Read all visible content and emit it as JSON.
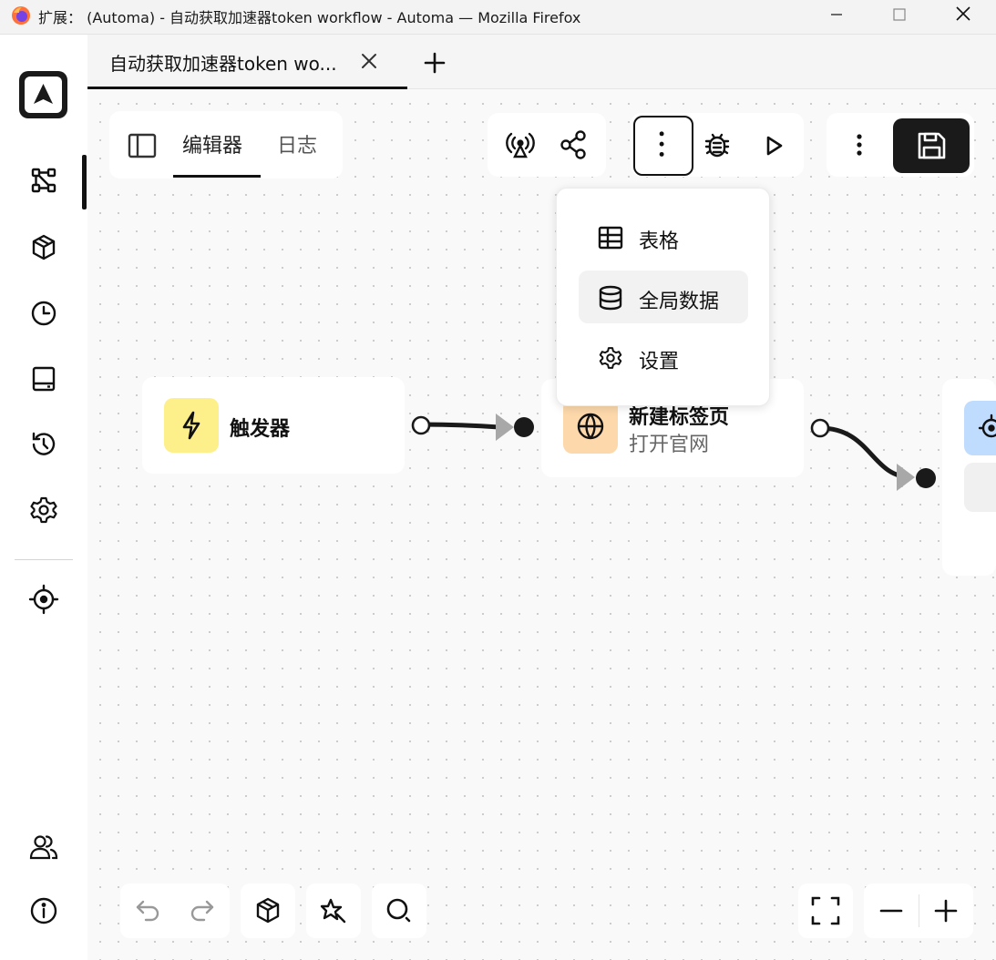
{
  "window": {
    "title": "扩展： (Automa) - 自动获取加速器token workflow - Automa — Mozilla Firefox"
  },
  "sidebar": {
    "items": [
      {
        "name": "workflows",
        "icon": "workflow-icon"
      },
      {
        "name": "packages",
        "icon": "cube-icon"
      },
      {
        "name": "schedule",
        "icon": "clock-icon"
      },
      {
        "name": "storage",
        "icon": "storage-icon"
      },
      {
        "name": "logs",
        "icon": "history-icon"
      },
      {
        "name": "settings",
        "icon": "gear-icon"
      },
      {
        "name": "recording",
        "icon": "target-icon"
      },
      {
        "name": "team",
        "icon": "users-icon"
      },
      {
        "name": "about",
        "icon": "info-icon"
      }
    ]
  },
  "tabs": [
    {
      "label": "自动获取加速器token wo...",
      "active": true
    }
  ],
  "editor": {
    "tab_editor": "编辑器",
    "tab_log": "日志"
  },
  "menu": {
    "items": [
      {
        "label": "表格",
        "icon": "table-icon"
      },
      {
        "label": "全局数据",
        "icon": "database-icon",
        "hovered": true
      },
      {
        "label": "设置",
        "icon": "gear-icon"
      }
    ]
  },
  "nodes": [
    {
      "title": "触发器",
      "description": "",
      "icon": "bolt-icon",
      "color": "#fdf08a"
    },
    {
      "title": "新建标签页",
      "description": "打开官网",
      "icon": "globe-icon",
      "color": "#fcd8ab"
    },
    {
      "title": "",
      "description": "",
      "icon": "target-icon",
      "color": "#bfdbfe"
    }
  ],
  "colors": {
    "accent": "#1a1a1a",
    "canvas": "#f9f9f9"
  }
}
